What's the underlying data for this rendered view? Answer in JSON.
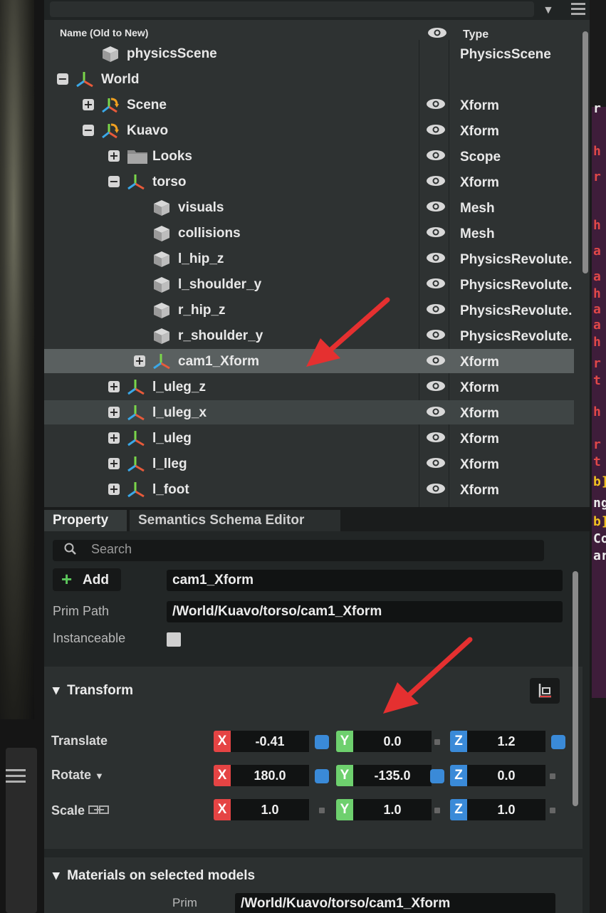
{
  "stage": {
    "header": {
      "name_col": "Name (Old to New)",
      "type_col": "Type"
    },
    "rows": [
      {
        "label": "physicsScene",
        "type": "PhysicsScene",
        "expander": "",
        "icon": "cube",
        "indent": 1,
        "eye": false
      },
      {
        "label": "World",
        "type": "",
        "expander": "−",
        "icon": "xform",
        "indent": 0,
        "eye": false
      },
      {
        "label": "Scene",
        "type": "Xform",
        "expander": "+",
        "icon": "scene",
        "indent": 1,
        "eye": true
      },
      {
        "label": "Kuavo",
        "type": "Xform",
        "expander": "−",
        "icon": "scene",
        "indent": 1,
        "eye": true
      },
      {
        "label": "Looks",
        "type": "Scope",
        "expander": "+",
        "icon": "folder",
        "indent": 2,
        "eye": true
      },
      {
        "label": "torso",
        "type": "Xform",
        "expander": "−",
        "icon": "xform",
        "indent": 2,
        "eye": true
      },
      {
        "label": "visuals",
        "type": "Mesh",
        "expander": "",
        "icon": "cube",
        "indent": 3,
        "eye": true
      },
      {
        "label": "collisions",
        "type": "Mesh",
        "expander": "",
        "icon": "cube",
        "indent": 3,
        "eye": true
      },
      {
        "label": "l_hip_z",
        "type": "PhysicsRevolute.",
        "expander": "",
        "icon": "cube",
        "indent": 3,
        "eye": true
      },
      {
        "label": "l_shoulder_y",
        "type": "PhysicsRevolute.",
        "expander": "",
        "icon": "cube",
        "indent": 3,
        "eye": true
      },
      {
        "label": "r_hip_z",
        "type": "PhysicsRevolute.",
        "expander": "",
        "icon": "cube",
        "indent": 3,
        "eye": true
      },
      {
        "label": "r_shoulder_y",
        "type": "PhysicsRevolute.",
        "expander": "",
        "icon": "cube",
        "indent": 3,
        "eye": true
      },
      {
        "label": "cam1_Xform",
        "type": "Xform",
        "expander": "+",
        "icon": "xform",
        "indent": 3,
        "eye": true,
        "state": "selected"
      },
      {
        "label": "l_uleg_z",
        "type": "Xform",
        "expander": "+",
        "icon": "xform",
        "indent": 2,
        "eye": true
      },
      {
        "label": "l_uleg_x",
        "type": "Xform",
        "expander": "+",
        "icon": "xform",
        "indent": 2,
        "eye": true,
        "state": "highlight"
      },
      {
        "label": "l_uleg",
        "type": "Xform",
        "expander": "+",
        "icon": "xform",
        "indent": 2,
        "eye": true
      },
      {
        "label": "l_lleg",
        "type": "Xform",
        "expander": "+",
        "icon": "xform",
        "indent": 2,
        "eye": true
      },
      {
        "label": "l_foot",
        "type": "Xform",
        "expander": "+",
        "icon": "xform",
        "indent": 2,
        "eye": true
      }
    ]
  },
  "property": {
    "tabs": {
      "active": "Property",
      "inactive": "Semantics Schema Editor"
    },
    "search_placeholder": "Search",
    "add_label": "Add",
    "prim_name": "cam1_Xform",
    "prim_path_label": "Prim Path",
    "prim_path": "/World/Kuavo/torso/cam1_Xform",
    "instanceable_label": "Instanceable",
    "transform": {
      "title": "Transform",
      "translate": {
        "label": "Translate",
        "x": "-0.41",
        "y": "0.0",
        "z": "1.2"
      },
      "rotate": {
        "label": "Rotate",
        "x": "180.0",
        "y": "-135.0",
        "z": "0.0"
      },
      "scale": {
        "label": "Scale",
        "x": "1.0",
        "y": "1.0",
        "z": "1.0"
      },
      "axis_x": "X",
      "axis_y": "Y",
      "axis_z": "Z"
    },
    "materials": {
      "title": "Materials on selected models",
      "prim_label": "Prim",
      "prim_value": "/World/Kuavo/torso/cam1_Xform"
    }
  },
  "terminal_chars": [
    {
      "text": "r",
      "color": "w"
    },
    {
      "text": "h",
      "color": "r"
    },
    {
      "text": "r",
      "color": "r"
    },
    {
      "text": "h",
      "color": "r"
    },
    {
      "text": "a",
      "color": "r"
    },
    {
      "text": "a",
      "color": "r"
    },
    {
      "text": "h",
      "color": "r"
    },
    {
      "text": "a",
      "color": "r"
    },
    {
      "text": "a",
      "color": "r"
    },
    {
      "text": "h",
      "color": "r"
    },
    {
      "text": "r",
      "color": "r"
    },
    {
      "text": "t",
      "color": "r"
    },
    {
      "text": "h",
      "color": "r"
    },
    {
      "text": "r",
      "color": "r"
    },
    {
      "text": "t",
      "color": "r"
    },
    {
      "text": "b]",
      "color": "y"
    },
    {
      "text": "ng",
      "color": "w"
    },
    {
      "text": "b]",
      "color": "y"
    },
    {
      "text": "Co",
      "color": "w"
    },
    {
      "text": "ar",
      "color": "w"
    }
  ],
  "colors": {
    "selected_row": "#5a6060",
    "axis_x": "#e54444",
    "axis_y": "#6ed06e",
    "axis_z": "#3a8ad8",
    "arrow": "#e53030"
  }
}
